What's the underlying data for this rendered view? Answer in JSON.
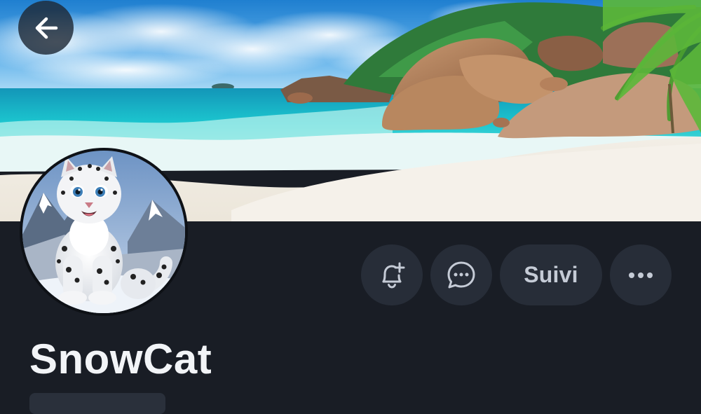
{
  "header": {
    "back_icon": "arrow-left-icon",
    "banner_image": "tropical-beach-banner"
  },
  "profile": {
    "avatar": "snow-leopard-cartoon-avatar",
    "name": "SnowCat"
  },
  "actions": {
    "notify_icon": "bell-plus-icon",
    "message_icon": "chat-bubble-icon",
    "follow_label": "Suivi",
    "more_icon": "more-horizontal-icon"
  },
  "colors": {
    "background": "#191d25",
    "button_bg": "#272d38",
    "button_fg": "#c5cbd6",
    "name_color": "#f2f4f7"
  }
}
